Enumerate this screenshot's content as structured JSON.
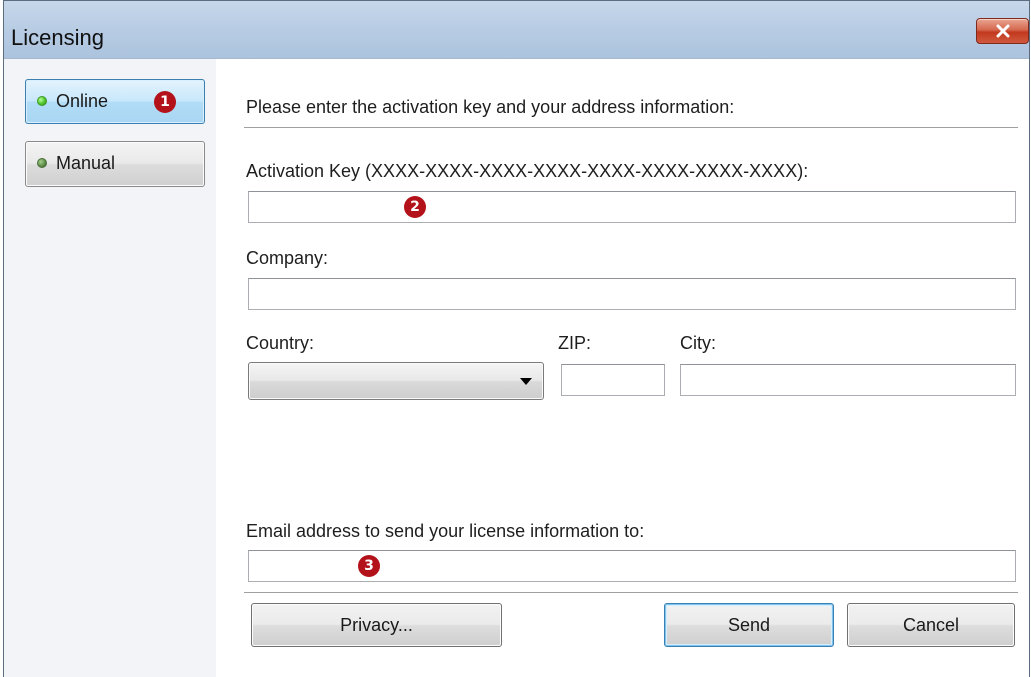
{
  "window": {
    "title": "Licensing",
    "close_icon": "close-icon"
  },
  "sidebar": {
    "items": [
      {
        "label": "Online",
        "status": "active",
        "marker": "1"
      },
      {
        "label": "Manual",
        "status": "inactive"
      }
    ]
  },
  "form": {
    "intro": "Please enter the activation key and your address information:",
    "activation_key": {
      "label": "Activation Key (XXXX-XXXX-XXXX-XXXX-XXXX-XXXX-XXXX-XXXX):",
      "value": "",
      "marker": "2"
    },
    "company": {
      "label": "Company:",
      "value": ""
    },
    "country": {
      "label": "Country:",
      "value": ""
    },
    "zip": {
      "label": "ZIP:",
      "value": ""
    },
    "city": {
      "label": "City:",
      "value": ""
    },
    "email": {
      "label": "Email address to send your license information to:",
      "value": "",
      "marker": "3"
    }
  },
  "buttons": {
    "privacy": "Privacy...",
    "send": "Send",
    "cancel": "Cancel"
  },
  "colors": {
    "titlebar": "#b9cde4",
    "close": "#c2391e",
    "marker": "#b4121b",
    "active_border": "#3c7fb1"
  }
}
